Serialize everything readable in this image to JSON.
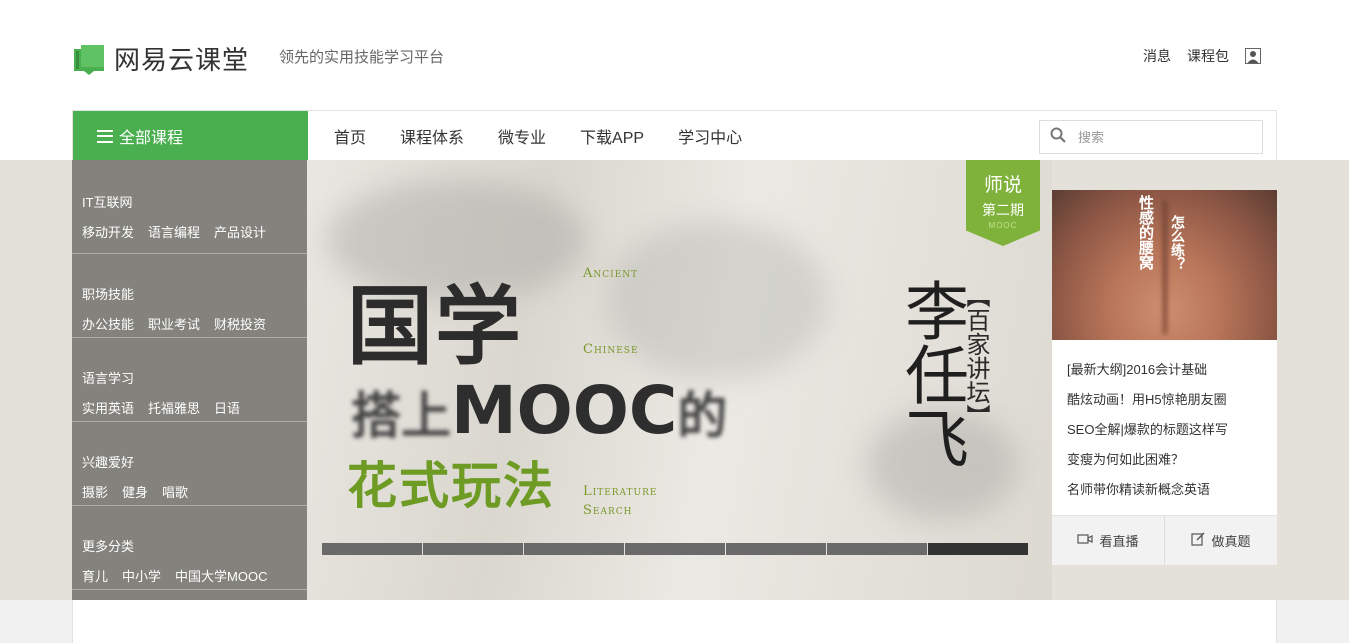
{
  "header": {
    "logo_text": "网易云课堂",
    "slogan": "领先的实用技能学习平台",
    "links": [
      "消息",
      "课程包"
    ],
    "brand_color": "#49af4f"
  },
  "nav": {
    "all_courses": "全部课程",
    "items": [
      "首页",
      "课程体系",
      "微专业",
      "下载APP",
      "学习中心"
    ],
    "search_placeholder": "搜索"
  },
  "categories": [
    {
      "title": "IT互联网",
      "subs": [
        "移动开发",
        "语言编程",
        "产品设计"
      ]
    },
    {
      "title": "职场技能",
      "subs": [
        "办公技能",
        "职业考试",
        "财税投资"
      ]
    },
    {
      "title": "语言学习",
      "subs": [
        "实用英语",
        "托福雅思",
        "日语"
      ]
    },
    {
      "title": "兴趣爱好",
      "subs": [
        "摄影",
        "健身",
        "唱歌"
      ]
    },
    {
      "title": "更多分类",
      "subs": [
        "育儿",
        "中小学",
        "中国大学MOOC"
      ]
    }
  ],
  "banner": {
    "ribbon_title": "师说",
    "ribbon_sub": "第二期",
    "ribbon_tag": "MOOC",
    "headline": "国学",
    "line2_a": "搭上",
    "line2_b": "MOOC",
    "line2_c": "的",
    "line3": "花式玩法",
    "en_words": [
      "Ancient",
      "Chinese",
      "Literature",
      "Search"
    ],
    "author": "李任飞",
    "program": "【百家讲坛】",
    "slide_count": 7,
    "active_slide": 7
  },
  "promo": {
    "image_text_1": "性感的腰窝",
    "image_text_2": "怎么练？",
    "links": [
      "[最新大纲]2016会计基础",
      "酷炫动画！用H5惊艳朋友圈",
      "SEO全解|爆款的标题这样写",
      "变瘦为何如此困难？",
      "名师带你精读新概念英语"
    ],
    "action_live": "看直播",
    "action_exam": "做真题"
  }
}
